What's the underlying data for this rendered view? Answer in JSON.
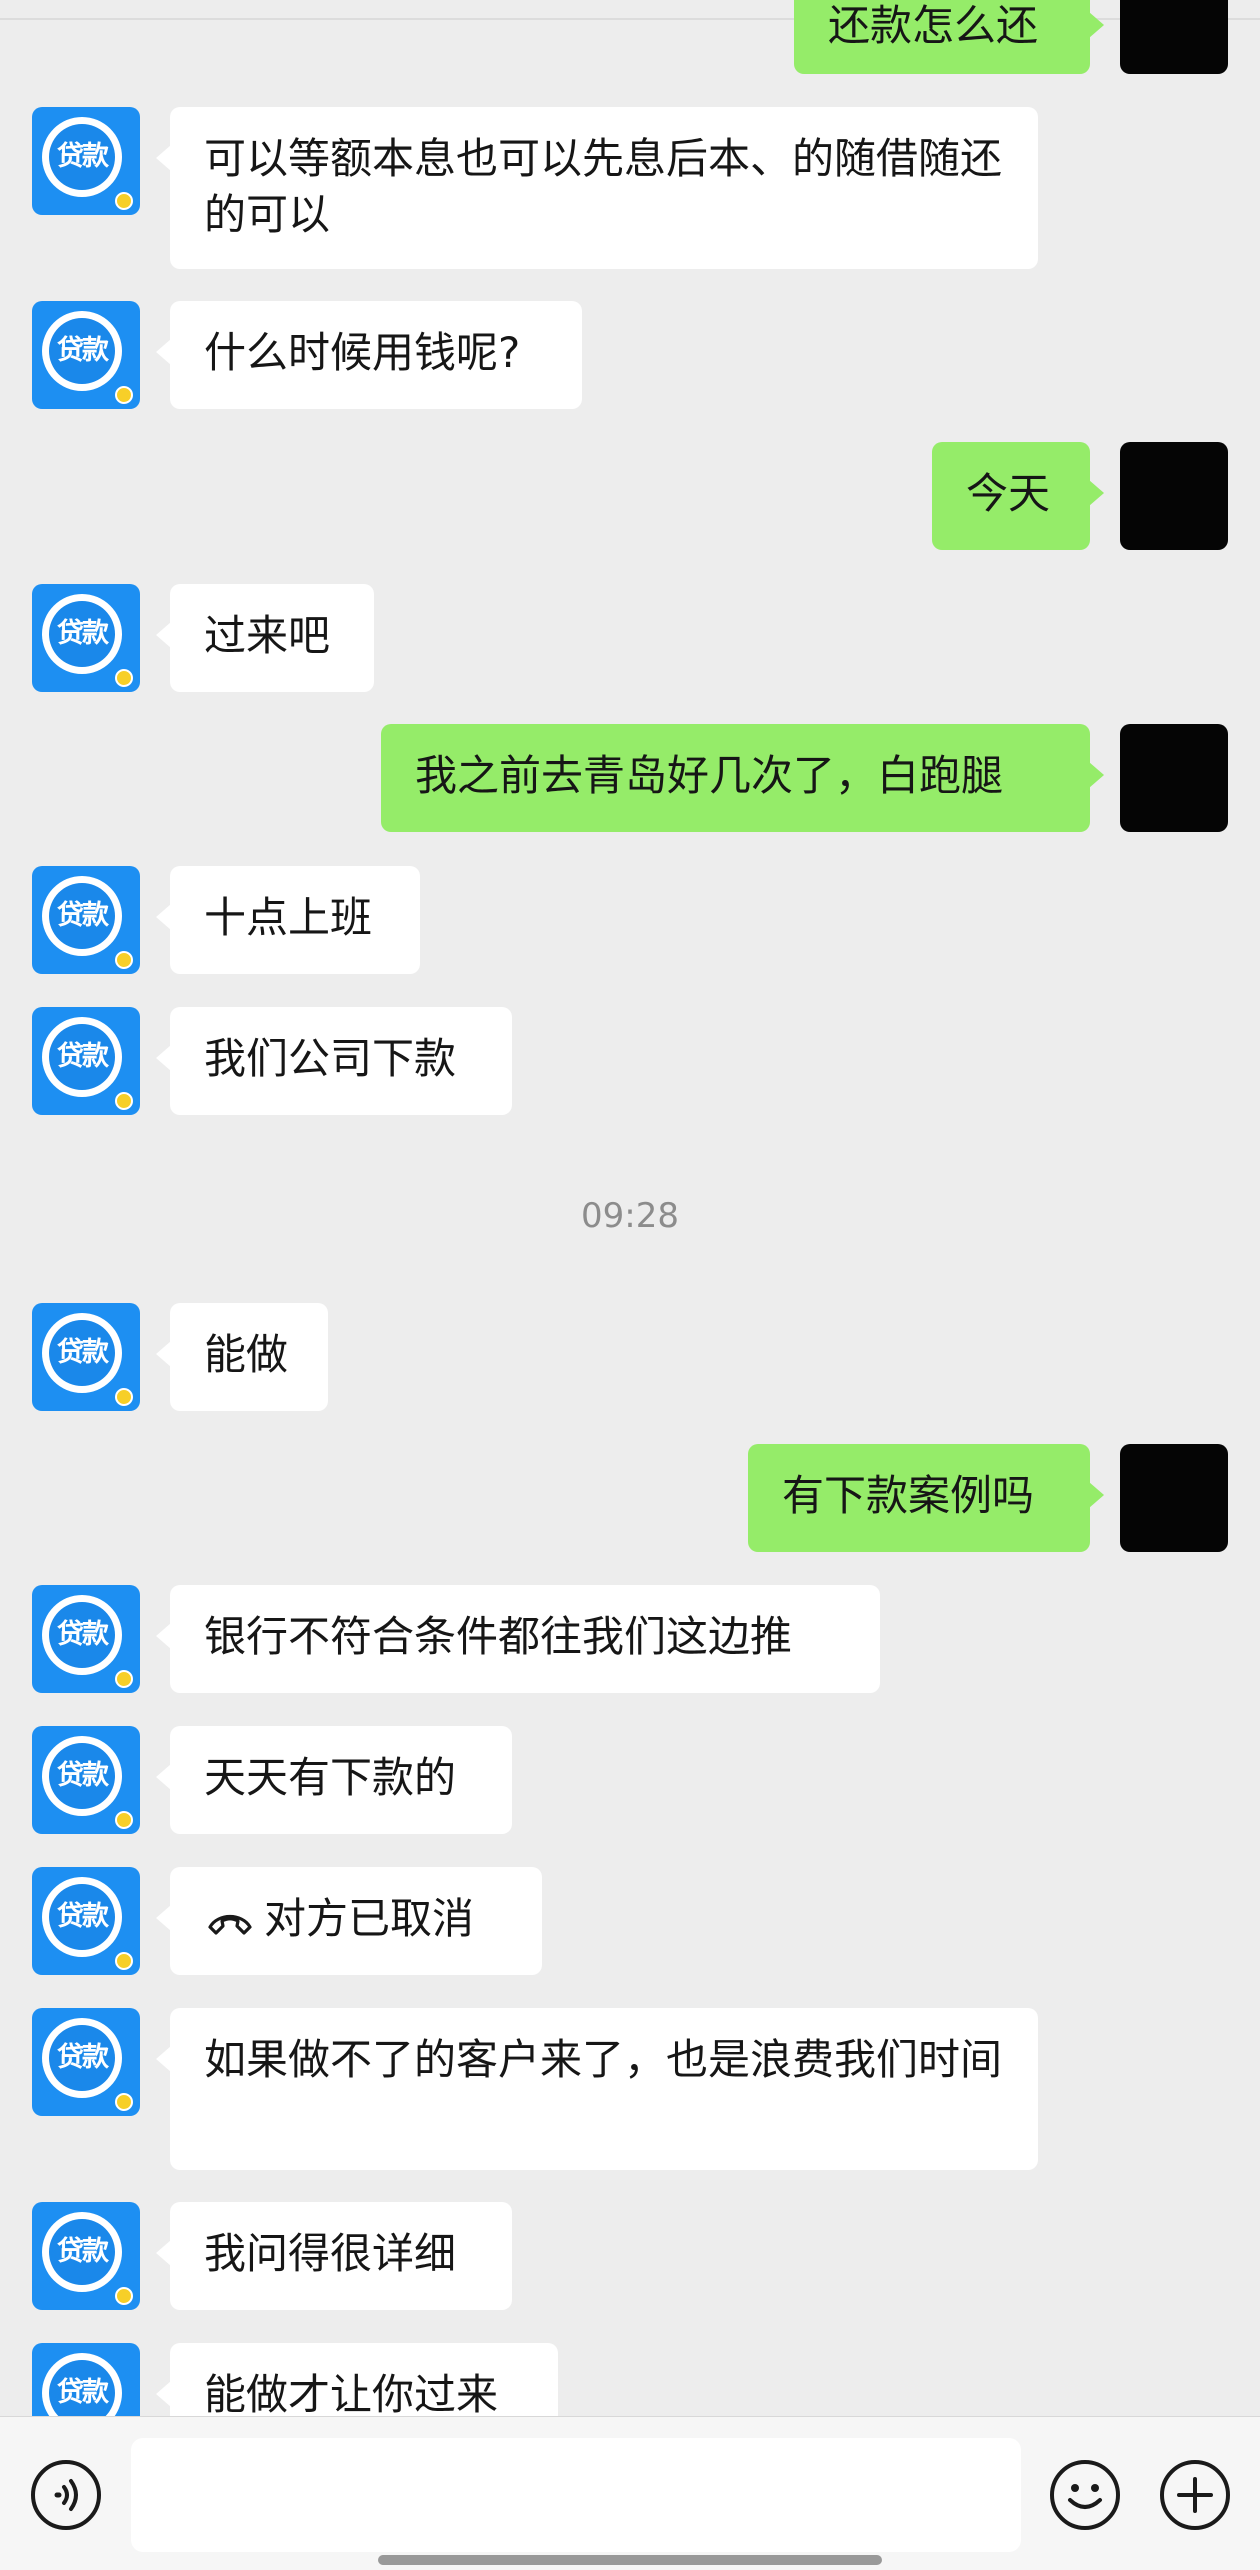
{
  "chat": {
    "messages": [
      {
        "side": "right",
        "text": "还款怎么还"
      },
      {
        "side": "left",
        "text": "可以等额本息也可以先息后本、的随借随还的可以"
      },
      {
        "side": "left",
        "text": "什么时候用钱呢?"
      },
      {
        "side": "right",
        "text": "今天"
      },
      {
        "side": "left",
        "text": "过来吧"
      },
      {
        "side": "right",
        "text": "我之前去青岛好几次了，白跑腿"
      },
      {
        "side": "left",
        "text": "十点上班"
      },
      {
        "side": "left",
        "text": "我们公司下款"
      },
      {
        "side": "left",
        "text": "能做"
      },
      {
        "side": "right",
        "text": "有下款案例吗"
      },
      {
        "side": "left",
        "text": "银行不符合条件都往我们这边推"
      },
      {
        "side": "left",
        "text": "天天有下款的"
      },
      {
        "side": "left",
        "text": "对方已取消"
      },
      {
        "side": "left",
        "text": "如果做不了的客户来了，也是浪费我们时间"
      },
      {
        "side": "left",
        "text": "我问得很详细"
      },
      {
        "side": "left",
        "text": "能做才让你过来"
      }
    ],
    "timestamp": "09:28",
    "contact_avatar_text": "贷款"
  },
  "input_bar": {
    "voice_icon": "voice-icon",
    "emoji_icon": "emoji-icon",
    "plus_icon": "plus-icon",
    "placeholder": ""
  },
  "colors": {
    "background": "#ededed",
    "sent_bubble": "#95ec69",
    "received_bubble": "#ffffff",
    "avatar_blue": "#1d8ff2"
  }
}
